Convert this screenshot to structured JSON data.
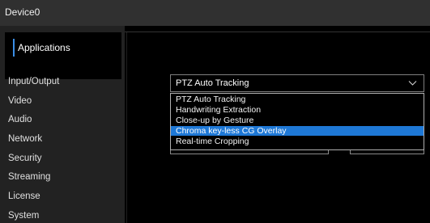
{
  "window": {
    "title": "Device0"
  },
  "sidebar": {
    "applications_label": "Applications",
    "items": [
      {
        "label": "Input/Output"
      },
      {
        "label": "Video"
      },
      {
        "label": "Audio"
      },
      {
        "label": "Network"
      },
      {
        "label": "Security"
      },
      {
        "label": "Streaming"
      },
      {
        "label": "License"
      },
      {
        "label": "System"
      }
    ]
  },
  "main": {
    "application_select": {
      "value": "PTZ Auto Tracking",
      "options": [
        {
          "label": "PTZ Auto Tracking",
          "selected": false
        },
        {
          "label": "Handwriting Extraction",
          "selected": false
        },
        {
          "label": "Close-up by Gesture",
          "selected": false
        },
        {
          "label": "Chroma key-less CG Overlay",
          "selected": true
        },
        {
          "label": "Real-time Cropping",
          "selected": false
        }
      ]
    }
  },
  "colors": {
    "accent": "#3a8ee6",
    "highlight": "#1e78d6",
    "titlebar": "#303030",
    "sidebar": "#222222"
  }
}
